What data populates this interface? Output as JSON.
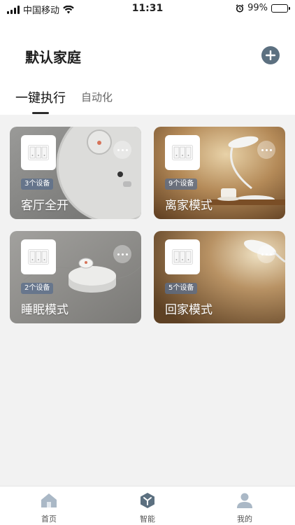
{
  "status_bar": {
    "carrier": "中国移动",
    "time": "11:31",
    "battery_percent": "99%",
    "battery_level": 0.99,
    "icons": [
      "signal-icon",
      "wifi-icon",
      "alarm-icon",
      "battery-charging-icon"
    ]
  },
  "header": {
    "home_name": "默认家庭",
    "add_icon": "plus-icon"
  },
  "tabs": [
    {
      "label": "一键执行",
      "active": true
    },
    {
      "label": "自动化",
      "active": false
    }
  ],
  "scenes": [
    {
      "name": "客厅全开",
      "device_count": "3个设备",
      "icon": "switch-panel-icon",
      "more_icon": "more-dots-icon"
    },
    {
      "name": "离家模式",
      "device_count": "9个设备",
      "icon": "switch-panel-icon",
      "more_icon": "more-dots-icon"
    },
    {
      "name": "睡眠模式",
      "device_count": "2个设备",
      "icon": "switch-panel-icon",
      "more_icon": "more-dots-icon"
    },
    {
      "name": "回家模式",
      "device_count": "5个设备",
      "icon": "switch-panel-icon",
      "more_icon": "more-dots-icon"
    }
  ],
  "tabbar": [
    {
      "label": "首页",
      "icon": "home-icon",
      "active": false
    },
    {
      "label": "智能",
      "icon": "smart-cube-icon",
      "active": true
    },
    {
      "label": "我的",
      "icon": "user-icon",
      "active": false
    }
  ],
  "colors": {
    "accent": "#5c7080",
    "content_bg": "#f2f2f2",
    "badge_bg": "#5a6e8c",
    "battery_green": "#4cd964"
  }
}
